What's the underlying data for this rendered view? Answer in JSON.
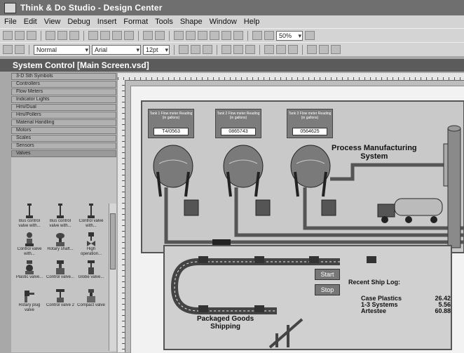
{
  "window": {
    "title": "Think & Do Studio - Design Center"
  },
  "menu": [
    "File",
    "Edit",
    "View",
    "Debug",
    "Insert",
    "Format",
    "Tools",
    "Shape",
    "Window",
    "Help"
  ],
  "toolbar": {
    "zoom": "50%",
    "style": "Normal",
    "font": "Arial",
    "size": "12pt"
  },
  "document": {
    "title": "System Control [Main Screen.vsd]"
  },
  "palette": {
    "categories": [
      "3-D Sth Symbols",
      "Controllers",
      "Flow Meters",
      "Indicator Lights",
      "Hmi/Dual",
      "Hmi/Pollers",
      "Material Handling",
      "Motors",
      "Scales",
      "Sensors",
      "Valves"
    ],
    "icons": [
      {
        "label": "Bus control valve with..."
      },
      {
        "label": "Bus control valve with..."
      },
      {
        "label": "Control valve with..."
      },
      {
        "label": "Control valve with..."
      },
      {
        "label": "Rotary shaft..."
      },
      {
        "label": "High operation..."
      },
      {
        "label": "Plastic valve..."
      },
      {
        "label": "Control valve..."
      },
      {
        "label": "Globe valve..."
      },
      {
        "label": "Rotary plug valve"
      },
      {
        "label": "Control valve 2"
      },
      {
        "label": "Compact valve"
      }
    ]
  },
  "tanks": [
    {
      "label": "Tank 1 Flow meter Reading (in gallons)",
      "value": "T4/0563"
    },
    {
      "label": "Tank 2 Flow meter Reading (in gallons)",
      "value": "0865743"
    },
    {
      "label": "Tank 3 Flow meter Reading (in gallons)",
      "value": "0564625"
    }
  ],
  "process": {
    "title_line1": "Process Manufacturing",
    "title_line2": "System"
  },
  "packaged": {
    "title_line1": "Packaged Goods",
    "title_line2": "Shipping"
  },
  "buttons": {
    "start": "Start",
    "stop": "Stop"
  },
  "shiplog": {
    "title": "Recent Ship Log:",
    "rows": [
      {
        "name": "Case Plastics",
        "value": "26.42"
      },
      {
        "name": "1-3 Systems",
        "value": "5.56"
      },
      {
        "name": "Artestee",
        "value": "60.88"
      }
    ]
  }
}
